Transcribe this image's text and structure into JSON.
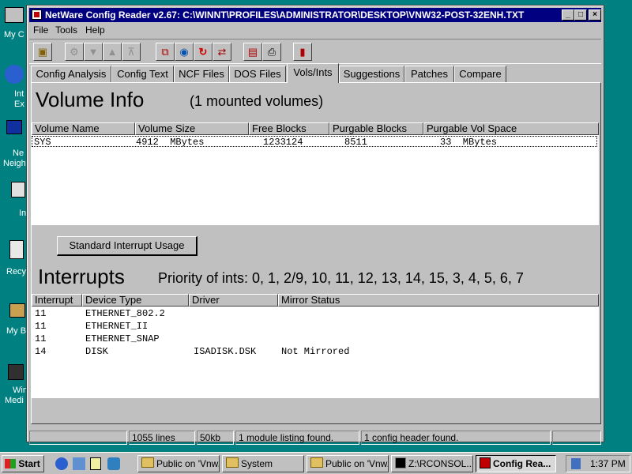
{
  "desktop": {
    "labels": [
      "My C",
      "Int",
      "Ex",
      "Ne",
      "Neigh",
      "In",
      "Recy",
      "My B",
      "Win",
      "Medi"
    ]
  },
  "window": {
    "title": "NetWare Config Reader v2.67:  C:\\WINNT\\PROFILES\\ADMINISTRATOR\\DESKTOP\\VNW32-POST-32ENH.TXT",
    "menu": [
      "File",
      "Tools",
      "Help"
    ],
    "tabs": [
      "Config Analysis",
      "Config Text",
      "NCF Files",
      "DOS Files",
      "Vols/Ints",
      "Suggestions",
      "Patches",
      "Compare"
    ],
    "active_tab": "Vols/Ints"
  },
  "volume_info": {
    "title": "Volume Info",
    "subtitle": "(1 mounted volumes)",
    "columns": [
      "Volume Name",
      "Volume Size",
      "Free Blocks",
      "Purgable Blocks",
      "Purgable Vol Space"
    ],
    "rows": [
      [
        "SYS",
        "4912  MBytes",
        "1233124",
        "8511",
        "33  MBytes"
      ]
    ]
  },
  "interrupts": {
    "button_label": "Standard Interrupt Usage",
    "title": "Interrupts",
    "priority": "Priority of ints: 0, 1, 2/9, 10, 11, 12, 13, 14, 15, 3, 4, 5, 6, 7",
    "columns": [
      "Interrupt",
      "Device Type",
      "Driver",
      "Mirror Status"
    ],
    "rows": [
      [
        "11",
        "ETHERNET_802.2",
        "",
        ""
      ],
      [
        "11",
        "ETHERNET_II",
        "",
        ""
      ],
      [
        "11",
        "ETHERNET_SNAP",
        "",
        ""
      ],
      [
        "14",
        "DISK",
        "ISADISK.DSK",
        "Not Mirrored"
      ]
    ]
  },
  "status_bar": [
    "",
    "1055 lines",
    "50kb",
    "1 module listing found.",
    "1 config header found.",
    ""
  ],
  "taskbar": {
    "start": "Start",
    "tasks": [
      "Public on 'Vnw...",
      "System",
      "Public on 'Vnw...",
      "Z:\\RCONSOL...",
      "Config Rea..."
    ],
    "clock": "1:37 PM"
  }
}
